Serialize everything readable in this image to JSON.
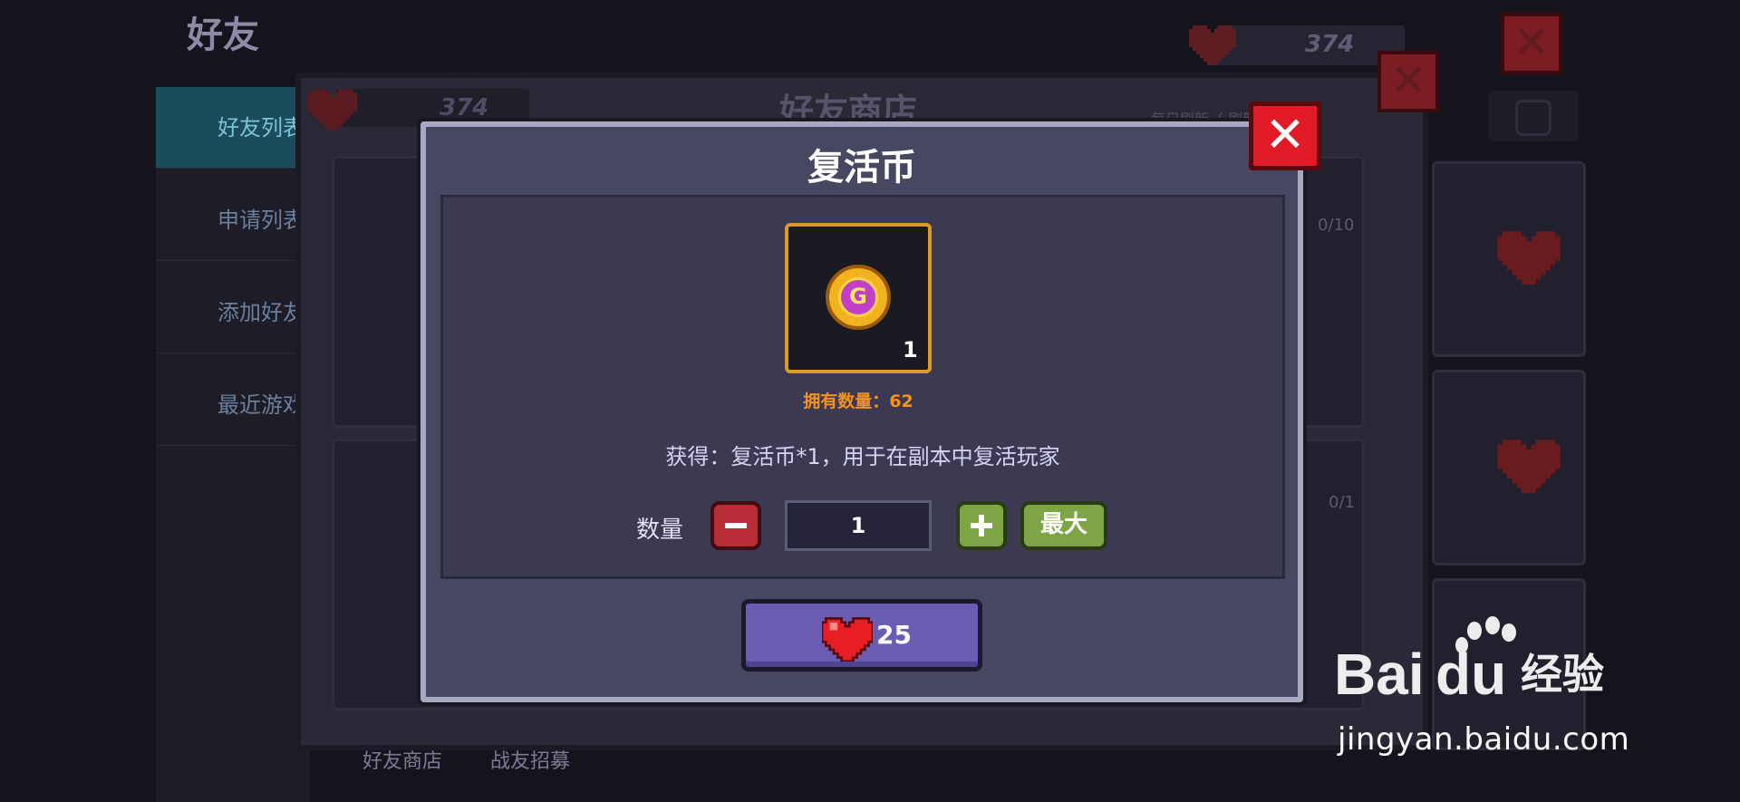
{
  "background": {
    "title": "好友",
    "sidebar": [
      {
        "label": "好友列表",
        "active": true
      },
      {
        "label": "申请列表",
        "active": false
      },
      {
        "label": "添加好友",
        "active": false
      },
      {
        "label": "最近游戏",
        "active": false
      }
    ],
    "hearts": "374",
    "tabs": [
      "好友商店",
      "战友招募"
    ]
  },
  "shop": {
    "title": "好友商店",
    "hearts": "374",
    "refresh_note": "每日刷新（ 刷新）",
    "slot_counts": [
      "0/10",
      "0/1"
    ]
  },
  "dialog": {
    "title": "复活币",
    "item": {
      "icon": "revive-coin-icon",
      "quantity": "1"
    },
    "owned_label": "拥有数量：62",
    "description": "获得：复活币*1，用于在副本中复活玩家",
    "quantity_label": "数量",
    "quantity_value": "1",
    "max_label": "最大",
    "price": "25",
    "currency_icon": "heart-icon",
    "close": "✕"
  },
  "watermark": {
    "brand": "Baidu经验",
    "url": "jingyan.baidu.com"
  },
  "colors": {
    "dialog_bg": "#484762",
    "close_red": "#e01a26",
    "plus_green": "#7da545",
    "minus_red": "#b72c35",
    "buy_purple": "#6a5cb0",
    "owned_orange": "#f3921c"
  }
}
